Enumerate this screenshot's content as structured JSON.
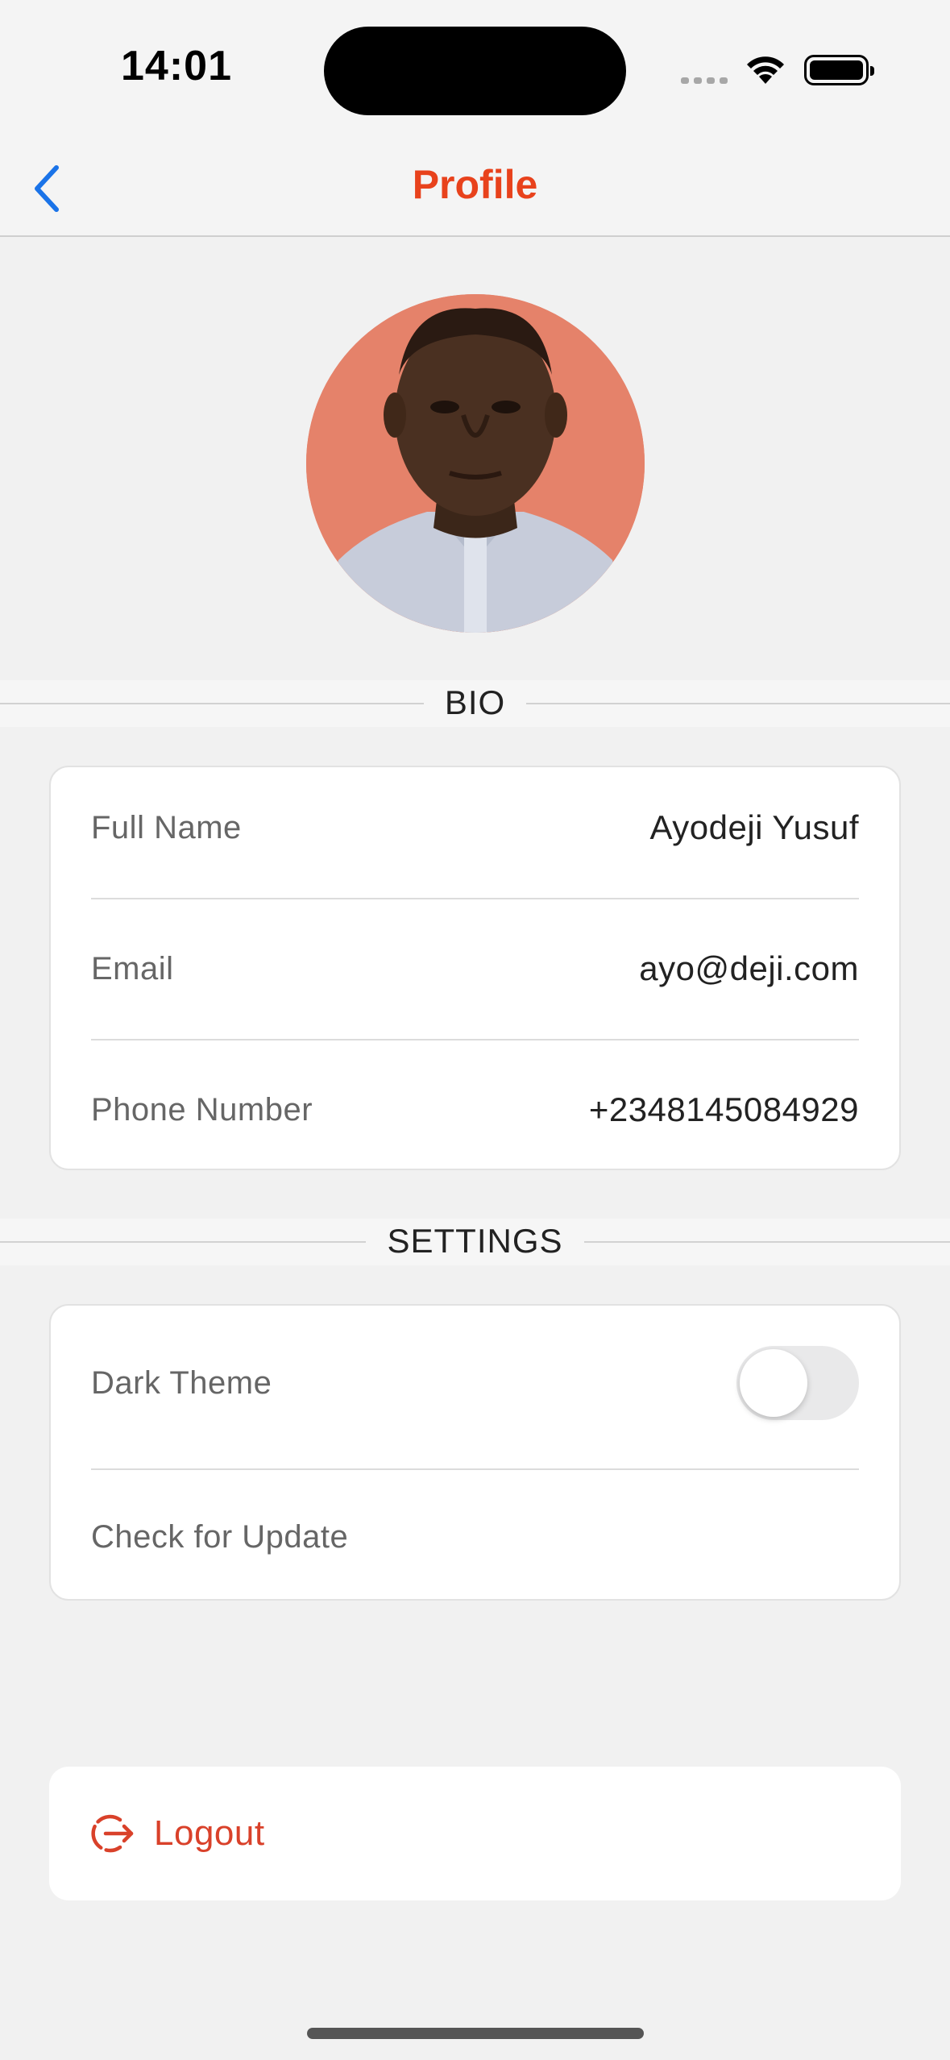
{
  "status_bar": {
    "time": "14:01"
  },
  "nav": {
    "title": "Profile"
  },
  "colors": {
    "accent": "#e8421c",
    "back": "#1a73e8",
    "logout": "#d9412a"
  },
  "bio": {
    "header": "BIO",
    "rows": [
      {
        "label": "Full Name",
        "value": "Ayodeji Yusuf"
      },
      {
        "label": "Email",
        "value": "ayo@deji.com"
      },
      {
        "label": "Phone Number",
        "value": "+2348145084929"
      }
    ]
  },
  "settings": {
    "header": "SETTINGS",
    "dark_theme_label": "Dark Theme",
    "dark_theme_on": false,
    "check_update_label": "Check for Update"
  },
  "logout": {
    "label": "Logout",
    "icon": "logout-icon"
  }
}
